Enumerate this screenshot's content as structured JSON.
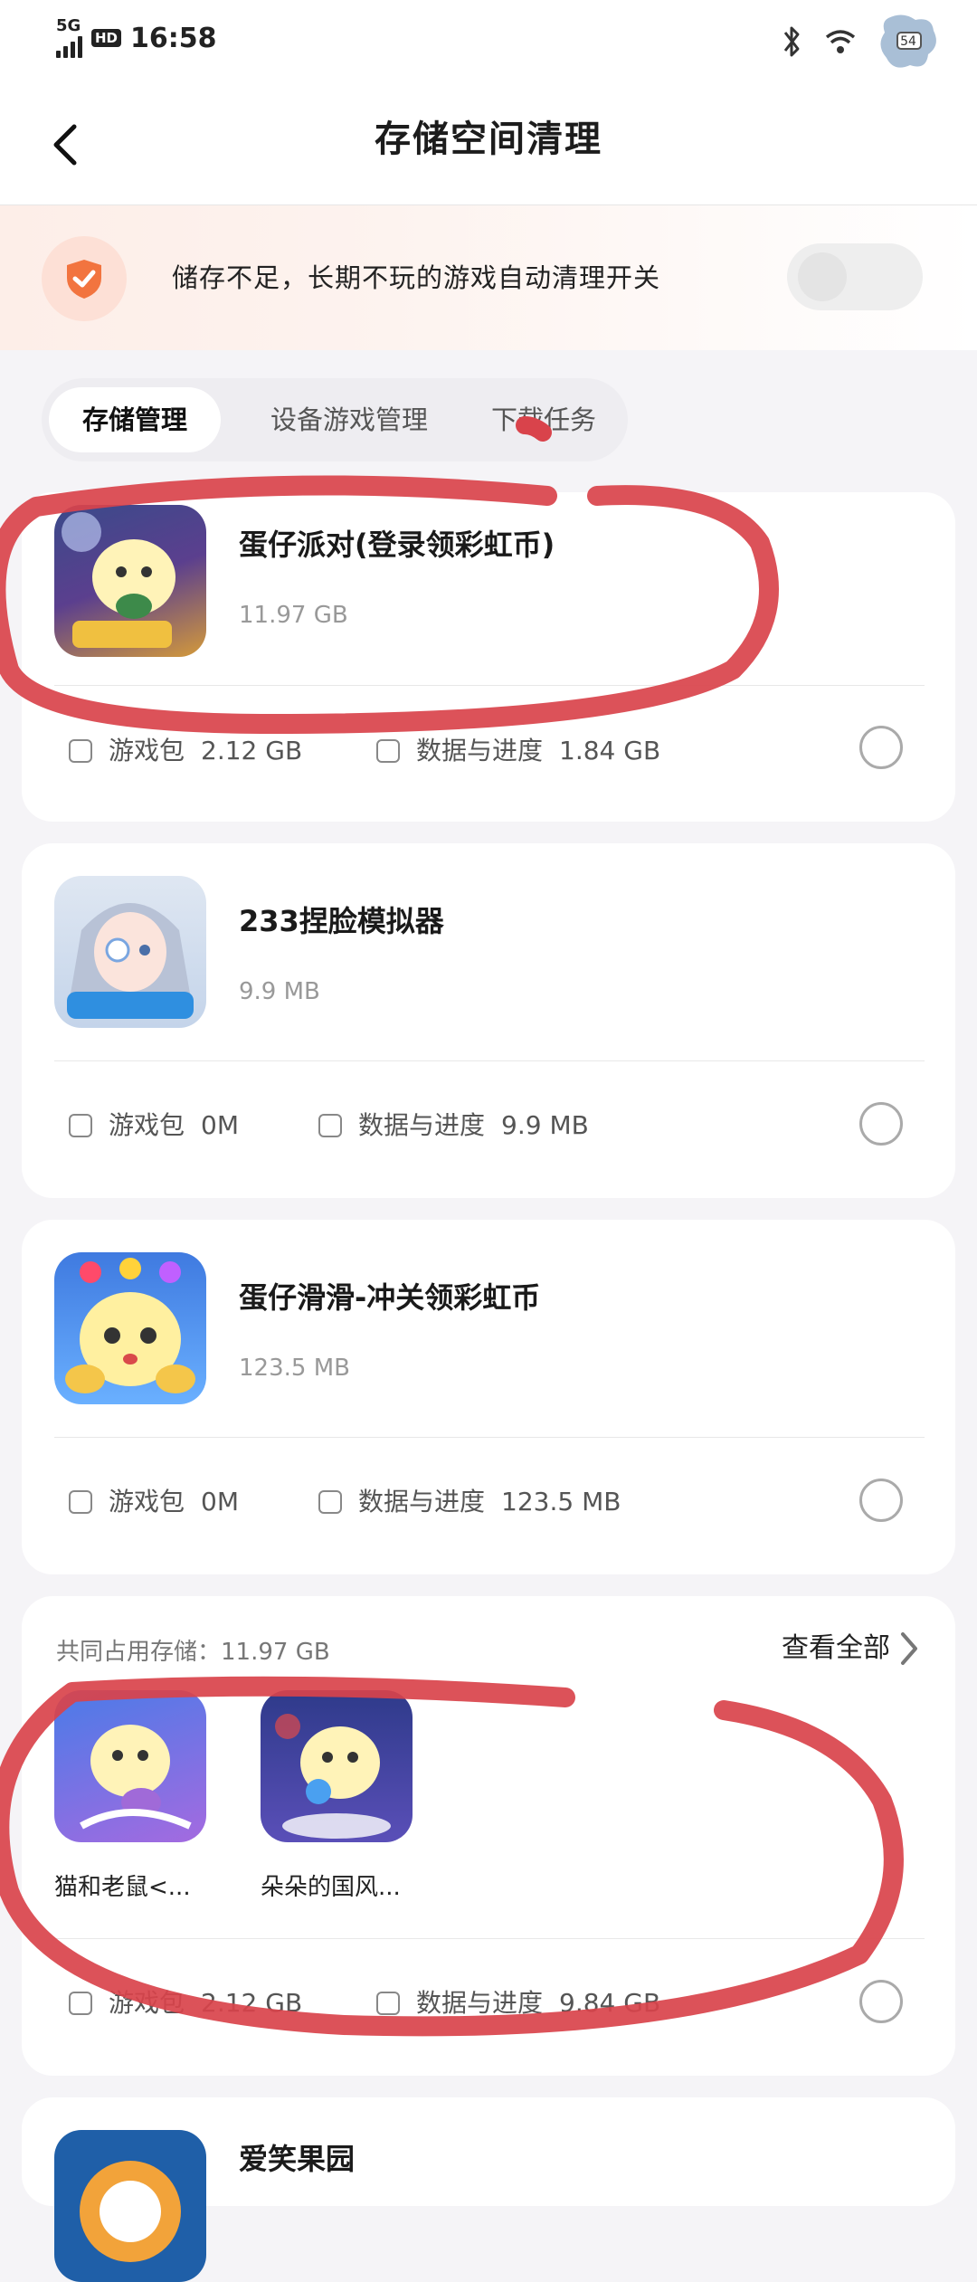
{
  "status_bar": {
    "network": "5G",
    "hd": "HD",
    "time": "16:58",
    "battery": "54"
  },
  "header": {
    "title": "存储空间清理"
  },
  "banner": {
    "text": "储存不足，长期不玩的游戏自动清理开关",
    "toggle_on": false
  },
  "tabs": [
    {
      "label": "存储管理",
      "active": true
    },
    {
      "label": "设备游戏管理",
      "active": false
    },
    {
      "label": "下载任务",
      "active": false
    }
  ],
  "games": [
    {
      "name": "蛋仔派对(登录领彩虹币)",
      "size": "11.97 GB",
      "package_label": "游戏包",
      "package_size": "2.12 GB",
      "data_label": "数据与进度",
      "data_size": "1.84 GB"
    },
    {
      "name": "233捏脸模拟器",
      "size": "9.9 MB",
      "package_label": "游戏包",
      "package_size": "0M",
      "data_label": "数据与进度",
      "data_size": "9.9 MB"
    },
    {
      "name": "蛋仔滑滑-冲关领彩虹币",
      "size": "123.5 MB",
      "package_label": "游戏包",
      "package_size": "0M",
      "data_label": "数据与进度",
      "data_size": "123.5 MB"
    }
  ],
  "shared": {
    "title": "共同占用存储：11.97 GB",
    "see_all": "查看全部",
    "apps": [
      {
        "name": "猫和老鼠<..."
      },
      {
        "name": "朵朵的国风..."
      }
    ],
    "package_label": "游戏包",
    "package_size": "2.12 GB",
    "data_label": "数据与进度",
    "data_size": "9.84 GB"
  },
  "last_card": {
    "name": "爱笑果园"
  },
  "colors": {
    "accent_orange": "#f2743f",
    "marker_red": "#d9434b",
    "background": "#f5f4f7"
  }
}
